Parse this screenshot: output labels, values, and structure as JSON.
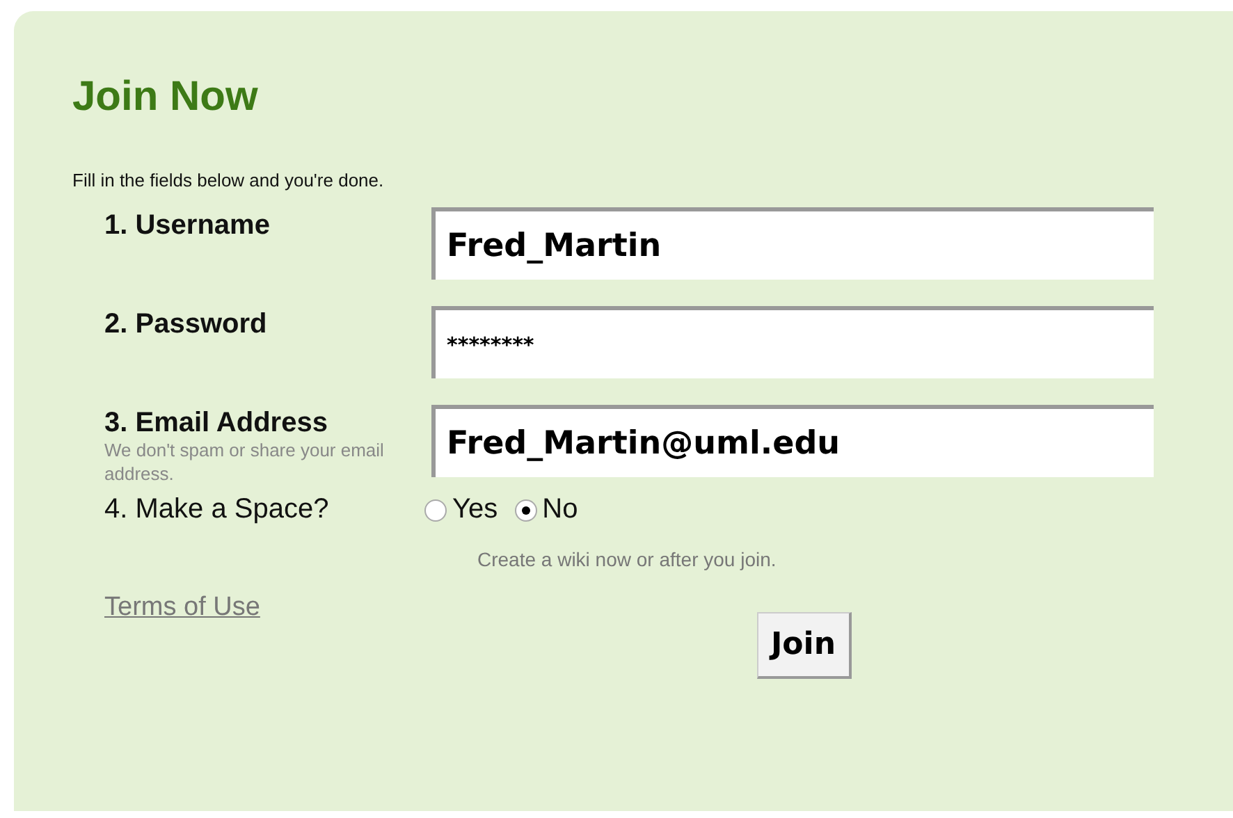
{
  "title": "Join Now",
  "intro": "Fill in the fields below and you're done.",
  "fields": [
    {
      "label": "1. Username",
      "value": "Fred_Martin"
    },
    {
      "label": "2. Password",
      "value": "********"
    },
    {
      "label": "3. Email Address",
      "hint": "We don't spam or share your email address.",
      "value": "Fred_Martin@uml.edu"
    }
  ],
  "space": {
    "label": "4. Make a Space?",
    "options": [
      {
        "label": "Yes",
        "selected": false
      },
      {
        "label": "No",
        "selected": true
      }
    ],
    "hint": "Create a wiki now or after you join."
  },
  "terms_link": "Terms of Use",
  "submit": "Join"
}
